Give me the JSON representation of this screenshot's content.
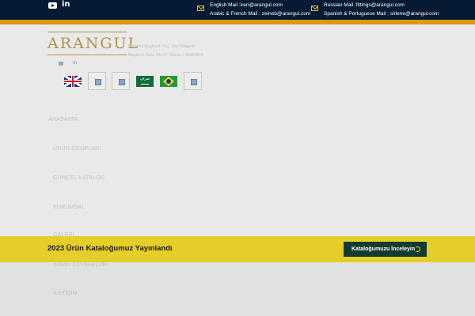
{
  "topbar": {
    "social": [
      "youtube-icon",
      "linkedin-icon"
    ],
    "mail_left": [
      "English Mail :iren@arangul.com",
      "Arabic & French Mail : zeineb@arangul.com"
    ],
    "mail_right": [
      "Russian Mail :fittings@arangul.com",
      "Spanish & Portuguese Mail : sirlene@arangul.com"
    ]
  },
  "brand": {
    "logo": "ARANGUL",
    "address_line1": "Malıköy Başkent Org. San Bölgesi",
    "address_line2": "Başkent Bulv. No:77 Sincan / ANKARA"
  },
  "languages": [
    "english-flag",
    "placeholder-flag",
    "placeholder-flag",
    "saudi-flag",
    "brazil-flag",
    "placeholder-flag"
  ],
  "flag_sa_text": "صرف",
  "nav": [
    "ANASAYFA",
    "ÜRÜN GRUPLARI",
    "GÜNCEL KATALOG",
    "KURUMSAL",
    "GALERİ",
    "İNSAN KAYNAKLARI",
    "İLETİŞİM"
  ],
  "banner": {
    "text": "2023 Ürün Kataloğumuz Yayınlandı",
    "button": "Kataloğumuzu İnceleyin"
  },
  "colors": {
    "topbar": "#061a33",
    "accent": "#d99a0d",
    "banner": "#e5cd2a",
    "button": "#123a30"
  }
}
